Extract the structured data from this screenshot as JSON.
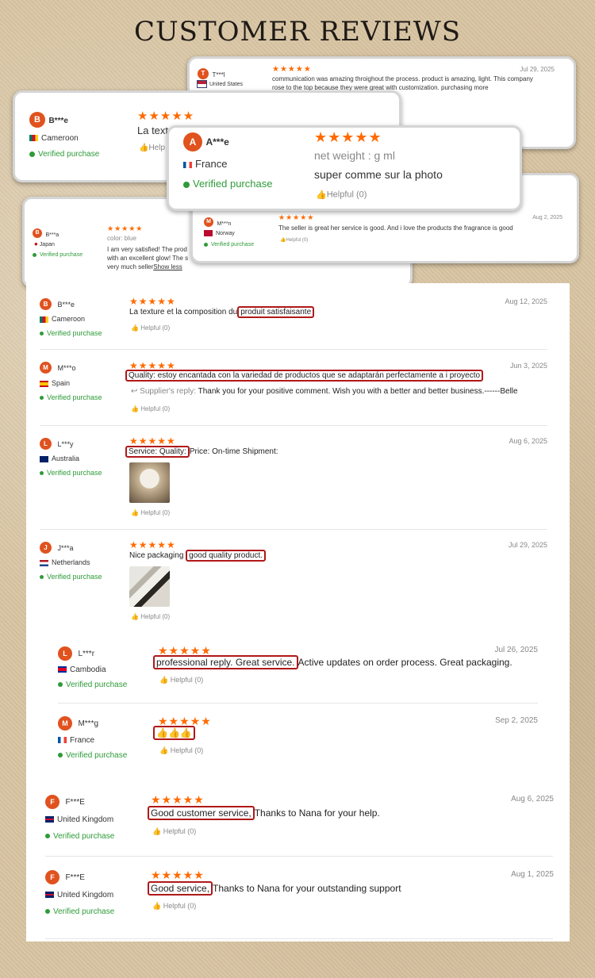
{
  "page_title": "CUSTOMER REVIEWS",
  "colors": {
    "accent_orange": "#e0521e",
    "star": "#ff6a00",
    "verified": "#2e9b39",
    "highlight": "#b01818"
  },
  "collage": {
    "card_t": {
      "avatar": "T",
      "name": "T***l",
      "country": "United States",
      "date": "Jul 29, 2025",
      "stars": "★★★★★",
      "text1": "communication was amazing throighout the process. product is amazing, light. This company",
      "text2": "rose to the top because they were great with customization. purchasing more"
    },
    "card_b": {
      "avatar": "B",
      "name": "B***e",
      "country": "Cameroon",
      "verified": "Verified purchase",
      "stars": "★★★★★",
      "text": "La textu",
      "helpful": "Help"
    },
    "card_a": {
      "avatar": "A",
      "name": "A***e",
      "country": "France",
      "verified": "Verified purchase",
      "stars": "★★★★★",
      "line1": "net weight : g ml",
      "line2": "super comme sur la photo",
      "helpful": "Helpful (0)"
    },
    "card_ba": {
      "avatar": "B",
      "name": "B***a",
      "country": "Japan",
      "verified": "Verified purchase",
      "stars": "★★★★★",
      "color_line": "color:  blue",
      "text1": "I am very satisfied! The prod",
      "text2": "with an excellent glow! The s",
      "text3": "very much seller",
      "show_less": "Show less"
    },
    "card_m": {
      "avatar": "M",
      "name": "M***n",
      "country": "Norway",
      "verified": "Verified purchase",
      "stars": "★★★★★",
      "date": "Aug 2, 2025",
      "text": "The seller is great her service is good. And i love the products the fragrance is good",
      "helpful": "Helpful (0)"
    }
  },
  "reviews": [
    {
      "avatar": "B",
      "name": "B***e",
      "country": "Cameroon",
      "verified": "Verified purchase",
      "stars": "★★★★★",
      "date": "Aug 12, 2025",
      "text_pre": "La texture et la composition du",
      "text_hl": "produit satisfaisante",
      "text_post": "",
      "helpful": "Helpful (0)"
    },
    {
      "avatar": "M",
      "name": "M***o",
      "country": "Spain",
      "verified": "Verified purchase",
      "stars": "★★★★★",
      "date": "Jun 3, 2025",
      "text_pre": "",
      "text_hl": "Quality: estoy encantada con la variedad de productos que se adaptarán perfectamente a i proyecto",
      "text_post": "",
      "reply_label": "Supplier's reply:",
      "reply_text": "Thank you for your positive comment. Wish you with a better and better business.------Belle",
      "helpful": "Helpful (0)"
    },
    {
      "avatar": "L",
      "name": "L***y",
      "country": "Australia",
      "verified": "Verified purchase",
      "stars": "★★★★★",
      "date": "Aug 6, 2025",
      "text_pre": "",
      "text_hl": "Service: Quality:",
      "text_post": "Price: On-time Shipment:",
      "helpful": "Helpful (0)"
    },
    {
      "avatar": "J",
      "name": "J***a",
      "country": "Netherlands",
      "verified": "Verified purchase",
      "stars": "★★★★★",
      "date": "Jul 29, 2025",
      "text_pre": "Nice packaging",
      "text_hl": "good quality product.",
      "text_post": "",
      "helpful": "Helpful (0)"
    },
    {
      "avatar": "L",
      "name": "L***r",
      "country": "Cambodia",
      "verified": "Verified purchase",
      "stars": "★★★★★",
      "date": "Jul 26, 2025",
      "text_pre": "",
      "text_hl": "professional reply. Great service.",
      "text_post": "Active updates on order process. Great packaging.",
      "helpful": "Helpful (0)"
    },
    {
      "avatar": "M",
      "name": "M***g",
      "country": "France",
      "verified": "Verified purchase",
      "stars": "★★★★★",
      "date": "Sep 2, 2025",
      "text_pre": "",
      "text_hl": "👍👍👍",
      "text_post": "",
      "helpful": "Helpful (0)"
    },
    {
      "avatar": "F",
      "name": "F***E",
      "country": "United Kingdom",
      "verified": "Verified purchase",
      "stars": "★★★★★",
      "date": "Aug 6, 2025",
      "text_pre": "",
      "text_hl": "Good customer service,",
      "text_post": "Thanks to Nana for your help.",
      "helpful": "Helpful (0)"
    },
    {
      "avatar": "F",
      "name": "F***E",
      "country": "United Kingdom",
      "verified": "Verified purchase",
      "stars": "★★★★★",
      "date": "Aug 1, 2025",
      "text_pre": "",
      "text_hl": "Good service,",
      "text_post": "Thanks to Nana for your outstanding support",
      "helpful": "Helpful (0)"
    }
  ]
}
